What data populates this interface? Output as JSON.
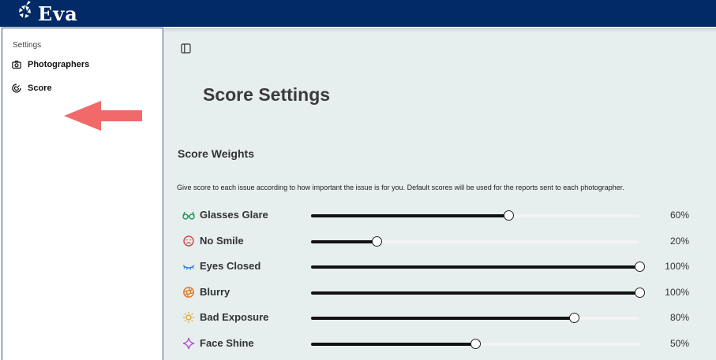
{
  "app": {
    "name": "Eva"
  },
  "sidebar": {
    "heading": "Settings",
    "items": [
      {
        "label": "Photographers",
        "icon": "camera-icon"
      },
      {
        "label": "Score",
        "icon": "gauge-icon",
        "active": true
      }
    ]
  },
  "main": {
    "title": "Score Settings",
    "section_title": "Score Weights",
    "description": "Give score to each issue according to how important the issue is for you. Default scores will be used for the reports sent to each photographer.",
    "weights": [
      {
        "label": "Glasses Glare",
        "value": 60,
        "display": "60%",
        "icon": "glasses-icon",
        "color": "#1aa25a"
      },
      {
        "label": "No Smile",
        "value": 20,
        "display": "20%",
        "icon": "frown-icon",
        "color": "#d94040"
      },
      {
        "label": "Eyes Closed",
        "value": 100,
        "display": "100%",
        "icon": "closed-eye-icon",
        "color": "#2e7bd6"
      },
      {
        "label": "Blurry",
        "value": 100,
        "display": "100%",
        "icon": "aperture-icon",
        "color": "#e8731a"
      },
      {
        "label": "Bad Exposure",
        "value": 80,
        "display": "80%",
        "icon": "sun-icon",
        "color": "#e0a020"
      },
      {
        "label": "Face Shine",
        "value": 50,
        "display": "50%",
        "icon": "sparkle-icon",
        "color": "#b04fd8"
      }
    ]
  },
  "colors": {
    "header": "#022a66",
    "content_bg": "#e6eeee",
    "arrow": "#f06a6a"
  }
}
